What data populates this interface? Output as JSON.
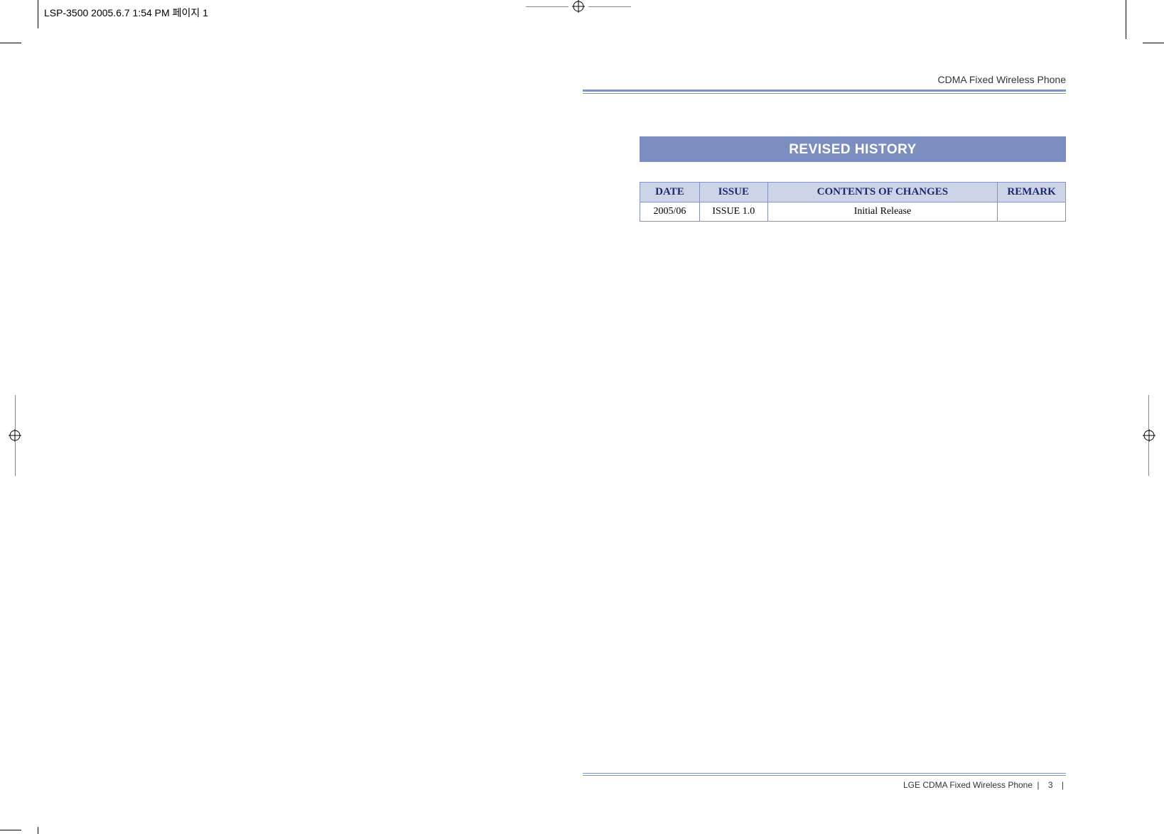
{
  "print_header": "LSP-3500  2005.6.7 1:54 PM  페이지 1",
  "header": {
    "title": "CDMA Fixed Wireless Phone"
  },
  "banner": {
    "title": "REVISED HISTORY"
  },
  "table": {
    "columns": {
      "date": "DATE",
      "issue": "ISSUE",
      "contents": "CONTENTS OF CHANGES",
      "remark": "REMARK"
    },
    "rows": [
      {
        "date": "2005/06",
        "issue": "ISSUE 1.0",
        "contents": "Initial Release",
        "remark": ""
      }
    ]
  },
  "footer": {
    "text": "LGE CDMA Fixed Wireless Phone",
    "page": "3"
  }
}
